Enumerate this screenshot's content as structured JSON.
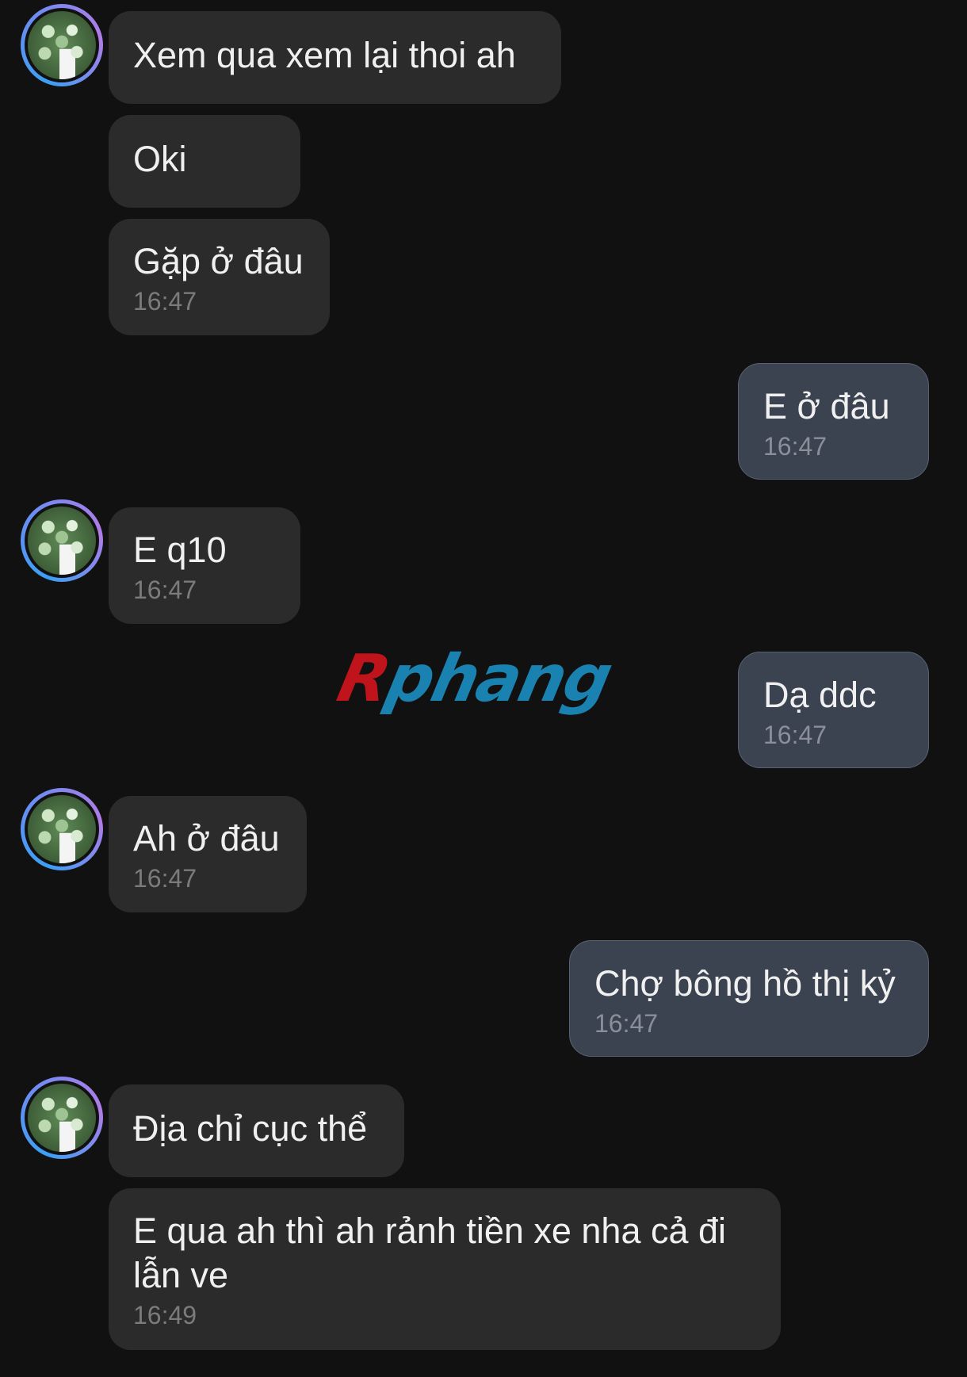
{
  "messages": [
    {
      "side": "in",
      "text": "Xem qua xem lại thoi ah",
      "time": ""
    },
    {
      "side": "in",
      "text": "Oki",
      "time": ""
    },
    {
      "side": "in",
      "text": "Gặp ở đâu",
      "time": "16:47"
    },
    {
      "side": "out",
      "text": "E ở đâu",
      "time": "16:47"
    },
    {
      "side": "in",
      "text": "E q10",
      "time": "16:47"
    },
    {
      "side": "out",
      "text": "Dạ ddc",
      "time": "16:47"
    },
    {
      "side": "in",
      "text": "Ah ở đâu",
      "time": "16:47"
    },
    {
      "side": "out",
      "text": "Chợ bông hồ thị kỷ",
      "time": "16:47"
    },
    {
      "side": "in",
      "text": "Địa chỉ cục thể",
      "time": ""
    },
    {
      "side": "in",
      "text": "E qua ah thì ah rảnh tiền xe nha cả đi\nlẫn ve",
      "time": "16:49"
    }
  ],
  "watermark": {
    "first": "R",
    "rest": "phang"
  },
  "colors": {
    "background": "#111111",
    "incoming": "#2b2b2b",
    "outgoing": "#3b4250",
    "time": "#7b7b7b"
  }
}
